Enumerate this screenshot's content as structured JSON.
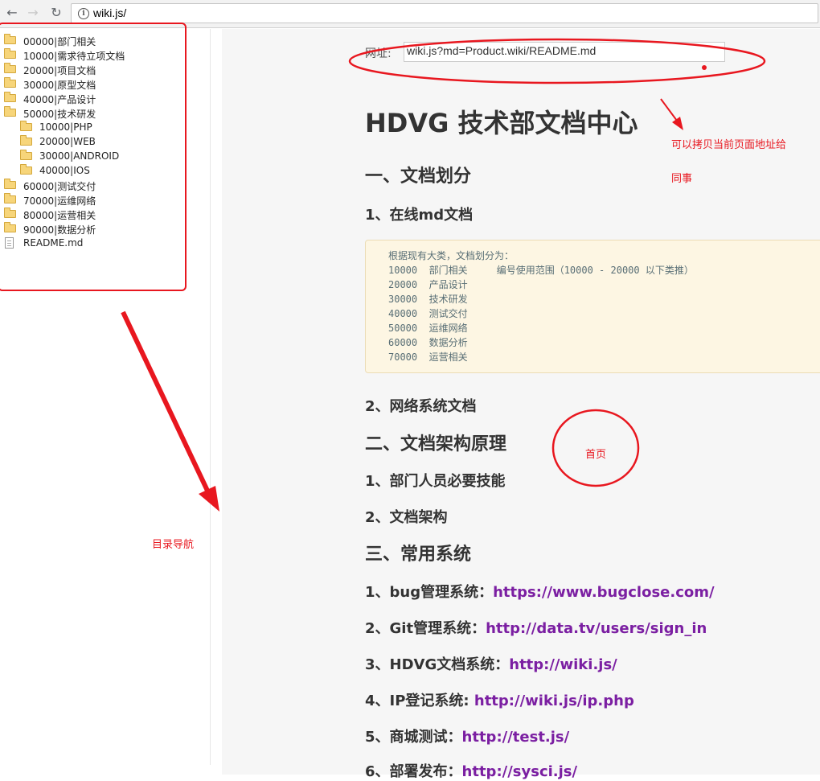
{
  "browser": {
    "back_glyph": "←",
    "forward_glyph": "→",
    "reload_glyph": "↻",
    "info_glyph": "i",
    "url": "wiki.js/"
  },
  "sidebar": {
    "items": [
      {
        "label": "00000|部门相关",
        "icon": "folder-icon",
        "indent": 0
      },
      {
        "label": "10000|需求待立项文档",
        "icon": "folder-icon",
        "indent": 0
      },
      {
        "label": "20000|项目文档",
        "icon": "folder-icon",
        "indent": 0
      },
      {
        "label": "30000|原型文档",
        "icon": "folder-icon",
        "indent": 0
      },
      {
        "label": "40000|产品设计",
        "icon": "folder-icon",
        "indent": 0
      },
      {
        "label": "50000|技术研发",
        "icon": "folder-open-icon",
        "indent": 0
      },
      {
        "label": "10000|PHP",
        "icon": "folder-icon",
        "indent": 1
      },
      {
        "label": "20000|WEB",
        "icon": "folder-icon",
        "indent": 1
      },
      {
        "label": "30000|ANDROID",
        "icon": "folder-icon",
        "indent": 1
      },
      {
        "label": "40000|IOS",
        "icon": "folder-icon",
        "indent": 1
      },
      {
        "label": "60000|测试交付",
        "icon": "folder-icon",
        "indent": 0
      },
      {
        "label": "70000|运维网络",
        "icon": "folder-icon",
        "indent": 0
      },
      {
        "label": "80000|运营相关",
        "icon": "folder-icon",
        "indent": 0
      },
      {
        "label": "90000|数据分析",
        "icon": "folder-icon",
        "indent": 0
      },
      {
        "label": "README.md",
        "icon": "file-icon",
        "indent": 0
      }
    ]
  },
  "main": {
    "address_label": "网址:",
    "address_value": "wiki.js?md=Product.wiki/README.md",
    "title": "HDVG 技术部文档中心",
    "section1": "一、文档划分",
    "s1_item1": "1、在线md文档",
    "code_lines": [
      "根据现有大类，文档划分为：",
      "10000  部门相关     编号使用范围（10000 - 20000 以下类推）",
      "20000  产品设计",
      "30000  技术研发",
      "40000  测试交付",
      "50000  运维网络",
      "60000  数据分析",
      "70000  运营相关"
    ],
    "s1_item2": "2、网络系统文档",
    "section2": "二、文档架构原理",
    "s2_item1": "1、部门人员必要技能",
    "s2_item2": "2、文档架构",
    "section3": "三、常用系统",
    "systems": [
      {
        "label": "1、bug管理系统：",
        "link": "https://www.bugclose.com/"
      },
      {
        "label": "2、Git管理系统：",
        "link": "http://data.tv/users/sign_in"
      },
      {
        "label": "3、HDVG文档系统：",
        "link": "http://wiki.js/"
      },
      {
        "label": "4、IP登记系统: ",
        "link": "http://wiki.js/ip.php"
      },
      {
        "label": "5、商城测试：",
        "link": "http://test.js/"
      },
      {
        "label": "6、部署发布：",
        "link": "http://sysci.js/"
      }
    ]
  },
  "annotations": {
    "copy_note_line1": "可以拷贝当前页面地址给",
    "copy_note_line2": "同事",
    "home_note": "首页",
    "nav_note": "目录导航",
    "color": "#e8171f"
  }
}
